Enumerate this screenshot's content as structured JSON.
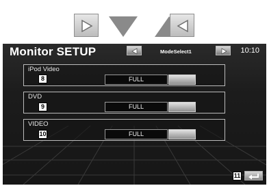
{
  "title": "Monitor SETUP",
  "clock": "10:10",
  "mode_select": {
    "label": "ModeSelect1"
  },
  "settings": [
    {
      "label": "iPod Video",
      "value": "FULL",
      "callout": "8"
    },
    {
      "label": "DVD",
      "value": "FULL",
      "callout": "9"
    },
    {
      "label": "VIDEO",
      "value": "FULL",
      "callout": "10"
    }
  ],
  "back": {
    "callout": "11"
  },
  "icons": [
    "play-right-icon",
    "triangle-down-icon",
    "triangle-up-icon",
    "play-left-icon",
    "arrow-left-icon",
    "arrow-right-icon",
    "return-icon"
  ],
  "colors": {
    "screen_bg": "#1c1c1c",
    "text": "#ffffff",
    "nav_gray": "#8e8e8e"
  }
}
